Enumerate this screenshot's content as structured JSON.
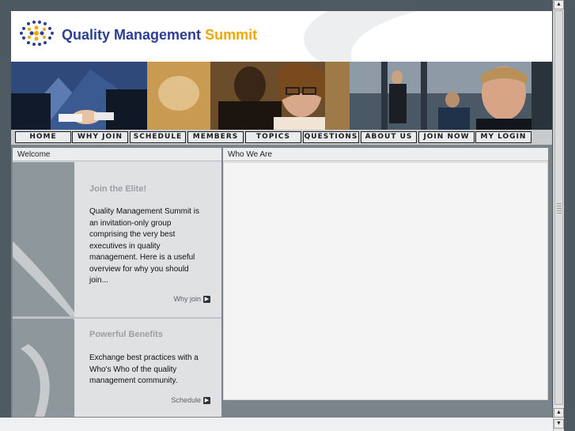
{
  "brand": {
    "name_part1": "Quality Management",
    "name_part2": "Summit",
    "colors": {
      "navy": "#2d3e93",
      "gold": "#f0a800"
    },
    "logo_icon": "dotted-globe-icon"
  },
  "nav": {
    "items": [
      "Home",
      "Why Join",
      "Schedule",
      "Members",
      "Topics",
      "Questions",
      "About Us",
      "Join Now",
      "My Login"
    ]
  },
  "left_panel": {
    "title": "Welcome",
    "cards": [
      {
        "heading": "Join the Elite!",
        "text": "Quality Management Summit is an invitation-only group comprising the very best executives in quality management. Here is a useful overview for why you should join...",
        "link": "Why join",
        "link_icon": "arrow-right-icon"
      },
      {
        "heading": "Powerful Benefits",
        "text": "Exchange best practices with a Who's Who of the quality management community.",
        "link": "Schedule",
        "link_icon": "arrow-right-icon"
      }
    ]
  },
  "right_panel": {
    "title": "Who We Are"
  }
}
